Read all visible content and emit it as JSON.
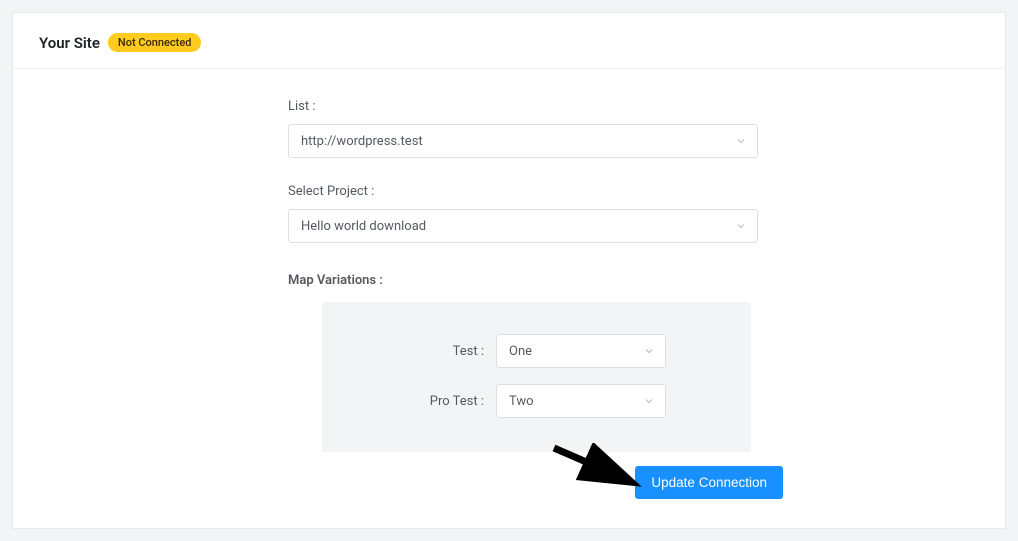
{
  "header": {
    "title": "Your Site",
    "status": "Not Connected"
  },
  "fields": {
    "list": {
      "label": "List :",
      "value": "http://wordpress.test"
    },
    "project": {
      "label": "Select Project :",
      "value": "Hello world download"
    }
  },
  "variations": {
    "label": "Map Variations :",
    "rows": [
      {
        "label": "Test :",
        "value": "One"
      },
      {
        "label": "Pro Test :",
        "value": "Two"
      }
    ]
  },
  "actions": {
    "update": "Update Connection"
  }
}
